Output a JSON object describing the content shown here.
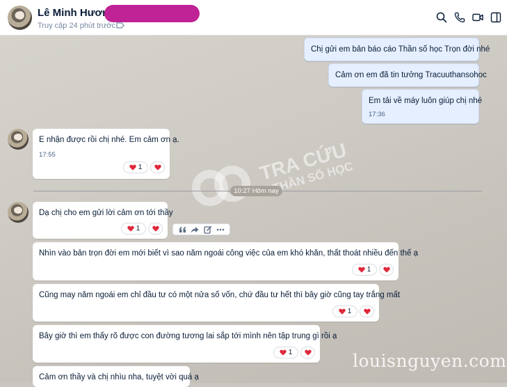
{
  "header": {
    "contact_name": "Lê Minh Hương -",
    "status": "Truy cập 24 phút trước",
    "icons": [
      "search-icon",
      "phone-icon",
      "video-icon",
      "side-panel-icon"
    ]
  },
  "messages": {
    "m1": {
      "text": "Chị gửi em bản báo cáo Thần số học Trọn đời nhé"
    },
    "m2": {
      "text": "Cảm ơn em đã tin tưởng Tracuuthansohoc"
    },
    "m3": {
      "text": "Em tải về máy luôn giúp chị nhé",
      "time": "17:36"
    },
    "m4": {
      "text": "E nhận được rồi chị nhé. Em cảm ơn ạ.",
      "time": "17:55",
      "reaction_count": "1"
    },
    "m5": {
      "text": "Dạ chị cho em gửi lời cảm ơn tới thầy",
      "reaction_count": "1"
    },
    "m6": {
      "text": "Nhìn vào bản trọn đời em mới biết vì sao năm ngoái công việc của em khó khăn, thất thoát nhiều đến thế ạ",
      "reaction_count": "1"
    },
    "m7": {
      "text": "Cũng may năm ngoái em chỉ đầu tư có một nửa số vốn, chứ đầu tư hết thì bây giờ cũng tay trắng mất",
      "reaction_count": "1"
    },
    "m8": {
      "text": "Bây giờ thì em thấy rõ được con đường tương lai sắp tới mình nên tập trung gì rồi ạ",
      "reaction_count": "1"
    },
    "m9": {
      "text": "Cảm ơn thầy và chị nhìu nha, tuyệt vời quá ạ"
    }
  },
  "separator": {
    "label": "10:27 Hôm nay"
  },
  "watermark": {
    "line1": "TRA CỨU",
    "line2": "THẦN SỐ HỌC"
  },
  "signature": "louisnguyen.com",
  "colors": {
    "redaction": "#c02396",
    "heart": "#e0283c",
    "my_bubble": "#e5efff",
    "link_blue": "#005ae0"
  }
}
